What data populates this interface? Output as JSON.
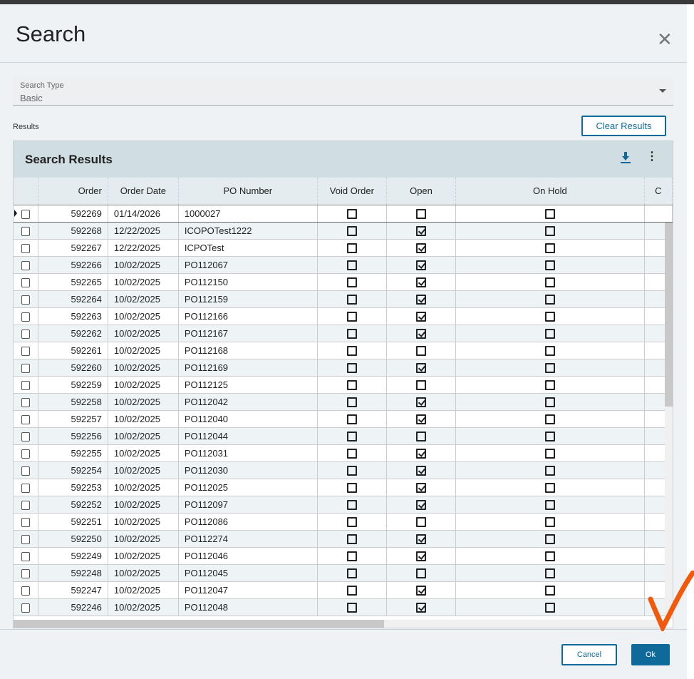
{
  "dialog": {
    "title": "Search",
    "close_icon": "close-icon"
  },
  "search_type": {
    "label": "Search Type",
    "value": "Basic"
  },
  "results_label": "Results",
  "clear_results": "Clear Results",
  "panel": {
    "title": "Search Results"
  },
  "columns": [
    "",
    "Order",
    "Order Date",
    "PO Number",
    "Void Order",
    "Open",
    "On Hold",
    "C"
  ],
  "rows": [
    {
      "order": "592269",
      "date": "01/14/2026",
      "po": "1000027",
      "void": false,
      "open": false,
      "hold": false
    },
    {
      "order": "592268",
      "date": "12/22/2025",
      "po": "ICOPOTest1222",
      "void": false,
      "open": true,
      "hold": false
    },
    {
      "order": "592267",
      "date": "12/22/2025",
      "po": "ICPOTest",
      "void": false,
      "open": true,
      "hold": false
    },
    {
      "order": "592266",
      "date": "10/02/2025",
      "po": "PO112067",
      "void": false,
      "open": true,
      "hold": false
    },
    {
      "order": "592265",
      "date": "10/02/2025",
      "po": "PO112150",
      "void": false,
      "open": true,
      "hold": false
    },
    {
      "order": "592264",
      "date": "10/02/2025",
      "po": "PO112159",
      "void": false,
      "open": true,
      "hold": false
    },
    {
      "order": "592263",
      "date": "10/02/2025",
      "po": "PO112166",
      "void": false,
      "open": true,
      "hold": false
    },
    {
      "order": "592262",
      "date": "10/02/2025",
      "po": "PO112167",
      "void": false,
      "open": true,
      "hold": false
    },
    {
      "order": "592261",
      "date": "10/02/2025",
      "po": "PO112168",
      "void": false,
      "open": false,
      "hold": false
    },
    {
      "order": "592260",
      "date": "10/02/2025",
      "po": "PO112169",
      "void": false,
      "open": true,
      "hold": false
    },
    {
      "order": "592259",
      "date": "10/02/2025",
      "po": "PO112125",
      "void": false,
      "open": false,
      "hold": false
    },
    {
      "order": "592258",
      "date": "10/02/2025",
      "po": "PO112042",
      "void": false,
      "open": true,
      "hold": false
    },
    {
      "order": "592257",
      "date": "10/02/2025",
      "po": "PO112040",
      "void": false,
      "open": true,
      "hold": false
    },
    {
      "order": "592256",
      "date": "10/02/2025",
      "po": "PO112044",
      "void": false,
      "open": false,
      "hold": false
    },
    {
      "order": "592255",
      "date": "10/02/2025",
      "po": "PO112031",
      "void": false,
      "open": true,
      "hold": false
    },
    {
      "order": "592254",
      "date": "10/02/2025",
      "po": "PO112030",
      "void": false,
      "open": true,
      "hold": false
    },
    {
      "order": "592253",
      "date": "10/02/2025",
      "po": "PO112025",
      "void": false,
      "open": true,
      "hold": false
    },
    {
      "order": "592252",
      "date": "10/02/2025",
      "po": "PO112097",
      "void": false,
      "open": true,
      "hold": false
    },
    {
      "order": "592251",
      "date": "10/02/2025",
      "po": "PO112086",
      "void": false,
      "open": false,
      "hold": false
    },
    {
      "order": "592250",
      "date": "10/02/2025",
      "po": "PO112274",
      "void": false,
      "open": true,
      "hold": false
    },
    {
      "order": "592249",
      "date": "10/02/2025",
      "po": "PO112046",
      "void": false,
      "open": true,
      "hold": false
    },
    {
      "order": "592248",
      "date": "10/02/2025",
      "po": "PO112045",
      "void": false,
      "open": false,
      "hold": false
    },
    {
      "order": "592247",
      "date": "10/02/2025",
      "po": "PO112047",
      "void": false,
      "open": true,
      "hold": false
    },
    {
      "order": "592246",
      "date": "10/02/2025",
      "po": "PO112048",
      "void": false,
      "open": true,
      "hold": false
    }
  ],
  "footer": {
    "cancel": "Cancel",
    "ok": "Ok"
  },
  "colors": {
    "accent": "#0f6a9a",
    "annotation": "#f05a0a"
  }
}
